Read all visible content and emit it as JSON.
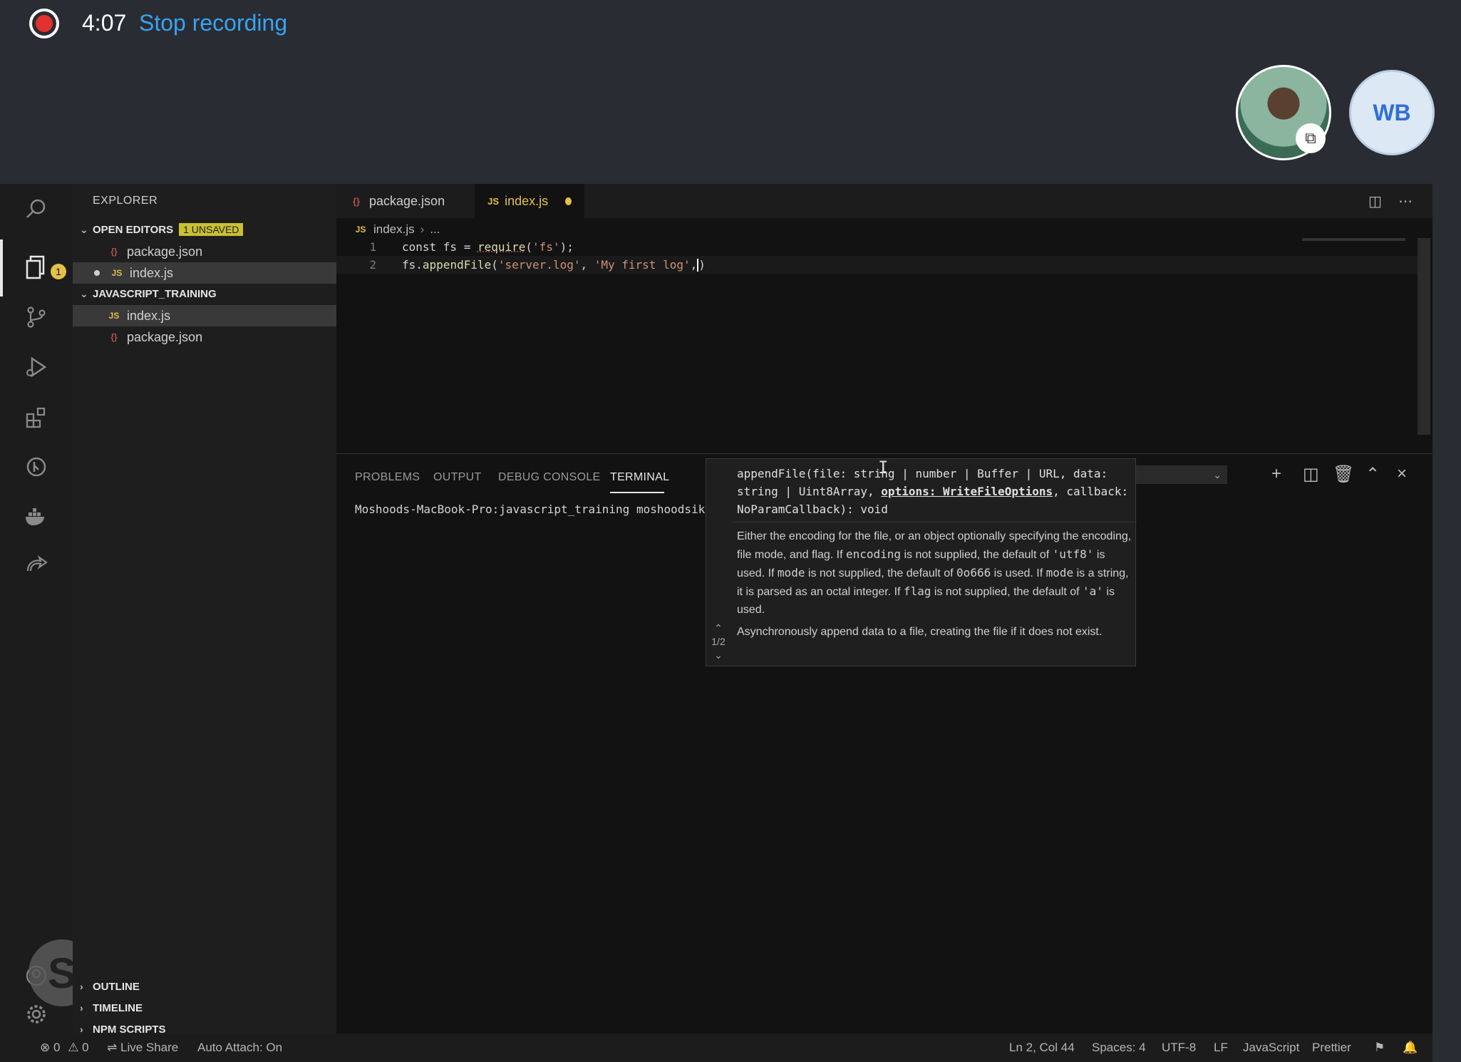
{
  "recording": {
    "time": "4:07",
    "stop_label": "Stop recording",
    "avatar_initials": "WB"
  },
  "sidebar": {
    "title": "EXPLORER",
    "open_editors": {
      "label": "OPEN EDITORS",
      "badge": "1 UNSAVED",
      "files": [
        {
          "name": "package.json",
          "type": "json"
        },
        {
          "name": "index.js",
          "type": "js",
          "dirty": true
        }
      ]
    },
    "workspace": {
      "label": "JAVASCRIPT_TRAINING",
      "files": [
        {
          "name": "index.js",
          "type": "js"
        },
        {
          "name": "package.json",
          "type": "json"
        }
      ]
    },
    "bottom_sections": [
      "OUTLINE",
      "TIMELINE",
      "NPM SCRIPTS"
    ],
    "activity_badge": "1"
  },
  "tabs": [
    {
      "label": "package.json",
      "active": false
    },
    {
      "label": "index.js",
      "active": true,
      "dirty": true
    }
  ],
  "breadcrumb": {
    "file": "index.js",
    "more": "..."
  },
  "code": {
    "lines": [
      {
        "num": "1",
        "text": "const fs = require('fs');"
      },
      {
        "num": "2",
        "text": "fs.appendFile('server.log', 'My first log',)"
      }
    ]
  },
  "hover": {
    "signature": "appendFile(file: string | number | Buffer | URL, data: string | Uint8Array, options: WriteFileOptions, callback: NoParamCallback): void",
    "nav": "1/2",
    "doc": "Either the encoding for the file, or an object optionally specifying the encoding, file mode, and flag. If encoding is not supplied, the default of 'utf8' is used. If mode is not supplied, the default of 0o666 is used. If mode is a string, it is parsed as an octal integer. If flag is not supplied, the default of 'a' is used.",
    "summary": "Asynchronously append data to a file, creating the file if it does not exist."
  },
  "panel": {
    "tabs": [
      "PROBLEMS",
      "OUTPUT",
      "DEBUG CONSOLE",
      "TERMINAL"
    ],
    "active_tab": "TERMINAL",
    "terminal_prompt": "Moshoods-MacBook-Pro:javascript_training moshoodsikiru$"
  },
  "status": {
    "errors": "0",
    "warnings": "0",
    "live_share": "Live Share",
    "auto_attach": "Auto Attach: On",
    "position": "Ln 2, Col 44",
    "spaces": "Spaces: 4",
    "encoding": "UTF-8",
    "eol": "LF",
    "language": "JavaScript",
    "formatter": "Prettier"
  }
}
